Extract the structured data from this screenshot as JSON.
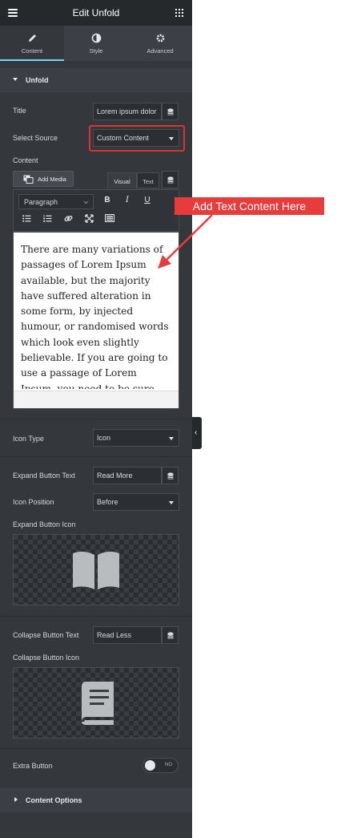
{
  "header": {
    "title": "Edit Unfold"
  },
  "tabs": [
    {
      "label": "Content",
      "icon": "pencil-icon"
    },
    {
      "label": "Style",
      "icon": "half-circle-icon"
    },
    {
      "label": "Advanced",
      "icon": "gear-icon"
    }
  ],
  "unfold_section": {
    "label": "Unfold"
  },
  "title_field": {
    "label": "Title",
    "value": "Lorem ipsum dolor"
  },
  "source_field": {
    "label": "Select Source",
    "value": "Custom Content"
  },
  "content": {
    "label": "Content",
    "add_media": "Add Media",
    "tab_visual": "Visual",
    "tab_text": "Text",
    "format": "Paragraph",
    "bold": "B",
    "italic": "I",
    "underline": "U",
    "body": "There are many variations of passages of Lorem Ipsum available, but the majority have suffered alteration in some form, by injected humour, or randomised words which look even slightly believable. If you are going to use a passage of Lorem Ipsum, you need to be sure there is anything"
  },
  "annotation": {
    "text": "Add Text Content Here",
    "color": "#e83b3b"
  },
  "icon_type": {
    "label": "Icon Type",
    "value": "Icon"
  },
  "expand_text": {
    "label": "Expand Button Text",
    "value": "Read More"
  },
  "icon_position": {
    "label": "Icon Position",
    "value": "Before"
  },
  "expand_icon": {
    "label": "Expand Button Icon",
    "icon": "book-open-icon"
  },
  "collapse_text": {
    "label": "Collapse Button Text",
    "value": "Read Less"
  },
  "collapse_icon": {
    "label": "Collapse Button Icon",
    "icon": "book-icon"
  },
  "extra_button": {
    "label": "Extra Button",
    "toggle_label": "NO"
  },
  "content_options": {
    "label": "Content Options"
  },
  "colors": {
    "panel": "#34383c",
    "header": "#26292c",
    "accent": "#71d7f7",
    "highlight": "#e0312f"
  }
}
